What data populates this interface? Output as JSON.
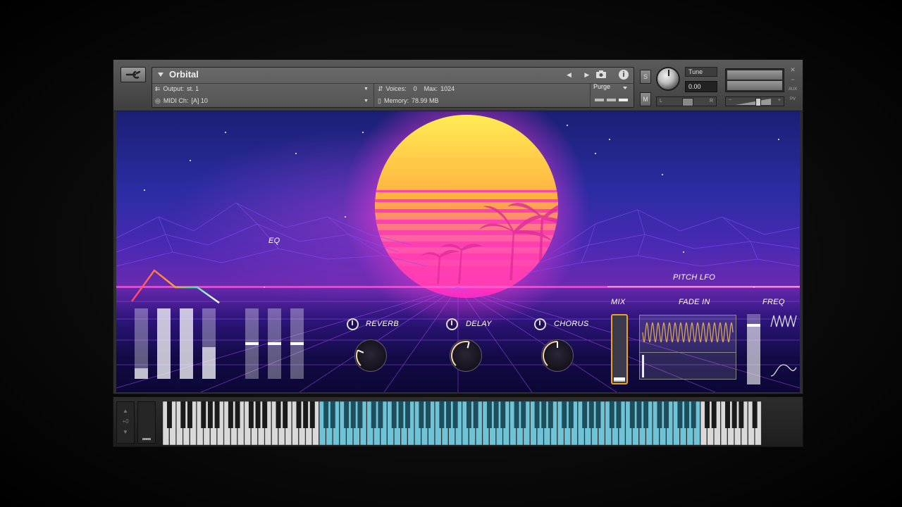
{
  "header": {
    "instrument_name": "Orbital",
    "output_label": "Output:",
    "output_value": "st. 1",
    "midi_label": "MIDI Ch:",
    "midi_value": "[A]  10",
    "voices_label": "Voices:",
    "voices_value": "0",
    "max_label": "Max:",
    "max_value": "1024",
    "memory_label": "Memory:",
    "memory_value": "78.99 MB",
    "purge_label": "Purge",
    "solo_label": "S",
    "mute_label": "M",
    "tune_label": "Tune",
    "tune_value": "0.00",
    "pan_left": "L",
    "pan_right": "R",
    "aux_label": "AUX",
    "pv_label": "PV"
  },
  "controls": {
    "eq_label": "EQ",
    "reverb_label": "REVERB",
    "delay_label": "DELAY",
    "chorus_label": "CHORUS",
    "pitch_lfo_label": "PITCH LFO",
    "mix_label": "MIX",
    "fade_in_label": "FADE IN",
    "freq_label": "FREQ"
  },
  "envelope_sliders": [
    0.15,
    1.0,
    1.0,
    0.45
  ],
  "eq_sliders": [
    0.5,
    0.5,
    0.5
  ],
  "knob_values": {
    "reverb": 0.25,
    "delay": 0.55,
    "chorus": 0.5
  },
  "mix_value": 0.05,
  "freq_value": 0.85,
  "keyboard": {
    "pitch_value": "+0",
    "highlight_start_white": 23,
    "highlight_end_white": 78,
    "white_key_count": 88
  },
  "colors": {
    "keyboard_highlight": "#6fc3d6",
    "sun_top": "#ffe94d",
    "sun_bottom": "#ff2fc6",
    "mix_border": "#e9a321",
    "lfo_wave": "#d6a65a"
  }
}
